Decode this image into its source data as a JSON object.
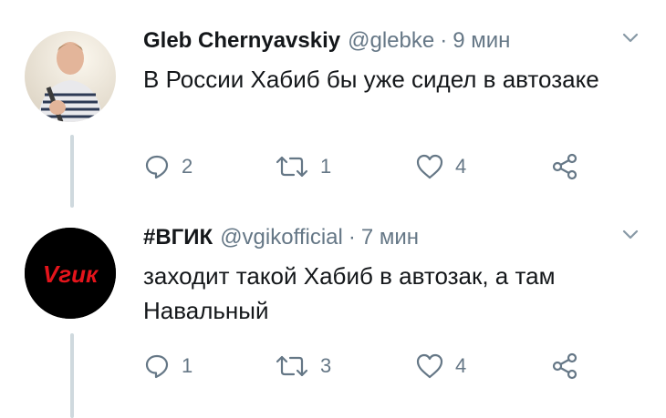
{
  "tweets": [
    {
      "author_name": "Gleb Chernyavskiy",
      "handle": "@glebke",
      "separator": "·",
      "time": "9 мин",
      "text": "В России Хабиб бы уже сидел в автозаке",
      "replies": "2",
      "retweets": "1",
      "likes": "4",
      "avatar": "user-photo-avatar"
    },
    {
      "author_name": "#ВГИК",
      "handle": "@vgikofficial",
      "separator": "·",
      "time": "7 мин",
      "text": "заходит такой Хабиб в автозак, а там Навальный",
      "replies": "1",
      "retweets": "3",
      "likes": "4",
      "avatar": "vgik-logo-avatar",
      "logo_text": "Vгик"
    }
  ],
  "colors": {
    "icon_gray": "#657786",
    "thread_line": "#cfd9de",
    "logo_red": "#e4141b"
  }
}
